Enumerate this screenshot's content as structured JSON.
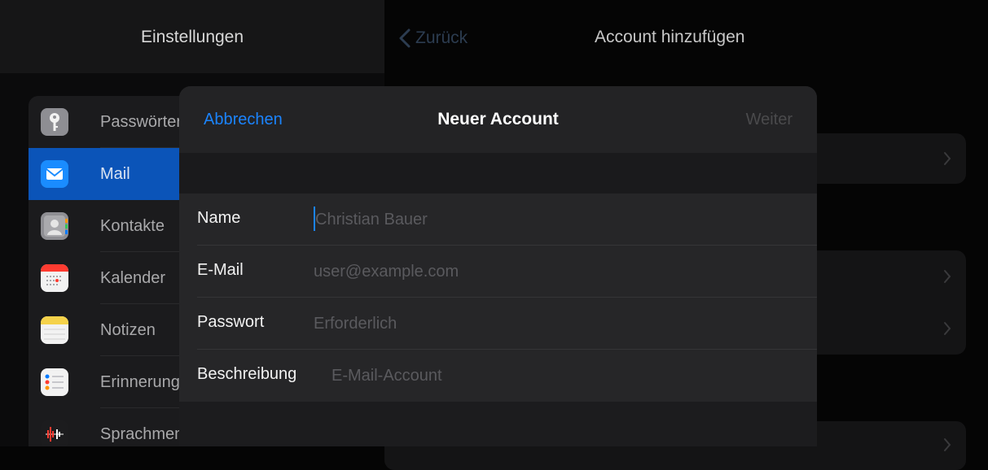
{
  "left_pane": {
    "title": "Einstellungen",
    "items": [
      {
        "label": "Passwörter",
        "icon": "key-icon",
        "color": "#8e8e93",
        "selected": false
      },
      {
        "label": "Mail",
        "icon": "mail-icon",
        "color": "#1a8cff",
        "selected": true
      },
      {
        "label": "Kontakte",
        "icon": "contacts-icon",
        "color": "#8e8e93",
        "selected": false
      },
      {
        "label": "Kalender",
        "icon": "calendar-icon",
        "color": "#f2f2f2",
        "selected": false
      },
      {
        "label": "Notizen",
        "icon": "notes-icon",
        "color": "#f5d24a",
        "selected": false
      },
      {
        "label": "Erinnerungen",
        "icon": "reminders-icon",
        "color": "#f2f2f2",
        "selected": false
      },
      {
        "label": "Sprachmemos",
        "icon": "voice-memos-icon",
        "color": "#1c1c1e",
        "selected": false
      }
    ]
  },
  "right_pane": {
    "back_label": "Zurück",
    "title": "Account hinzufügen"
  },
  "modal": {
    "cancel_label": "Abbrechen",
    "title": "Neuer Account",
    "next_label": "Weiter",
    "fields": [
      {
        "label": "Name",
        "placeholder": "Christian Bauer",
        "value": ""
      },
      {
        "label": "E-Mail",
        "placeholder": "user@example.com",
        "value": ""
      },
      {
        "label": "Passwort",
        "placeholder": "Erforderlich",
        "value": ""
      },
      {
        "label": "Beschreibung",
        "placeholder": "E-Mail-Account",
        "value": ""
      }
    ]
  },
  "colors": {
    "accent": "#1b84ff",
    "selected_row": "#0b54b8",
    "background": "#050505"
  }
}
